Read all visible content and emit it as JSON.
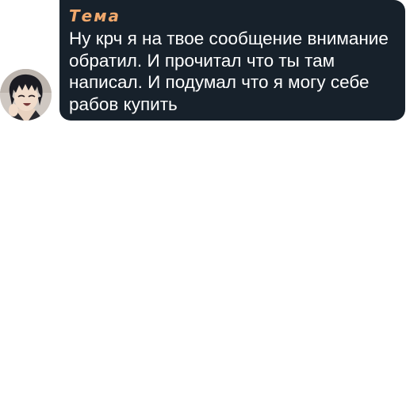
{
  "message": {
    "sender_name": "Тема",
    "sender_color": "#f0a86c",
    "text": "Ну крч я на твое сообщение внимание обратил. И прочитал что ты там написал. И подумал что я могу себе рабов купить",
    "bubble_color": "#17212b"
  },
  "avatar": {
    "icon": "anime-character-avatar"
  }
}
